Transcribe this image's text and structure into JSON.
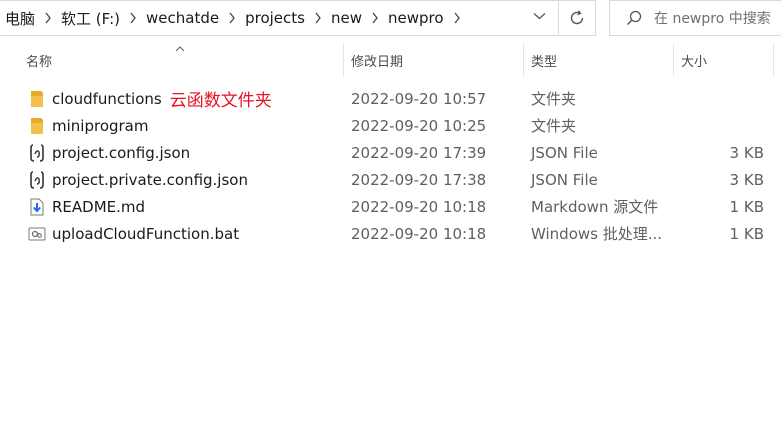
{
  "breadcrumb": {
    "items": [
      "电脑",
      "软工 (F:)",
      "wechatde",
      "projects",
      "new",
      "newpro"
    ]
  },
  "search": {
    "placeholder": "在 newpro 中搜索"
  },
  "columns": {
    "name": "名称",
    "date": "修改日期",
    "type": "类型",
    "size": "大小"
  },
  "files": [
    {
      "icon": "folder-icon",
      "name": "cloudfunctions",
      "annotation": "云函数文件夹",
      "date": "2022-09-20 10:57",
      "type": "文件夹",
      "size": ""
    },
    {
      "icon": "folder-icon",
      "name": "miniprogram",
      "annotation": "",
      "date": "2022-09-20 10:25",
      "type": "文件夹",
      "size": ""
    },
    {
      "icon": "json-file-icon",
      "name": "project.config.json",
      "annotation": "",
      "date": "2022-09-20 17:39",
      "type": "JSON File",
      "size": "3 KB"
    },
    {
      "icon": "json-file-icon",
      "name": "project.private.config.json",
      "annotation": "",
      "date": "2022-09-20 17:38",
      "type": "JSON File",
      "size": "3 KB"
    },
    {
      "icon": "markdown-file-icon",
      "name": "README.md",
      "annotation": "",
      "date": "2022-09-20 10:18",
      "type": "Markdown 源文件",
      "size": "1 KB"
    },
    {
      "icon": "batch-file-icon",
      "name": "uploadCloudFunction.bat",
      "annotation": "",
      "date": "2022-09-20 10:18",
      "type": "Windows 批处理...",
      "size": "1 KB"
    }
  ],
  "colors": {
    "annotation": "#e81123",
    "folder": "#f3c04a",
    "border": "#d9d9d9"
  }
}
